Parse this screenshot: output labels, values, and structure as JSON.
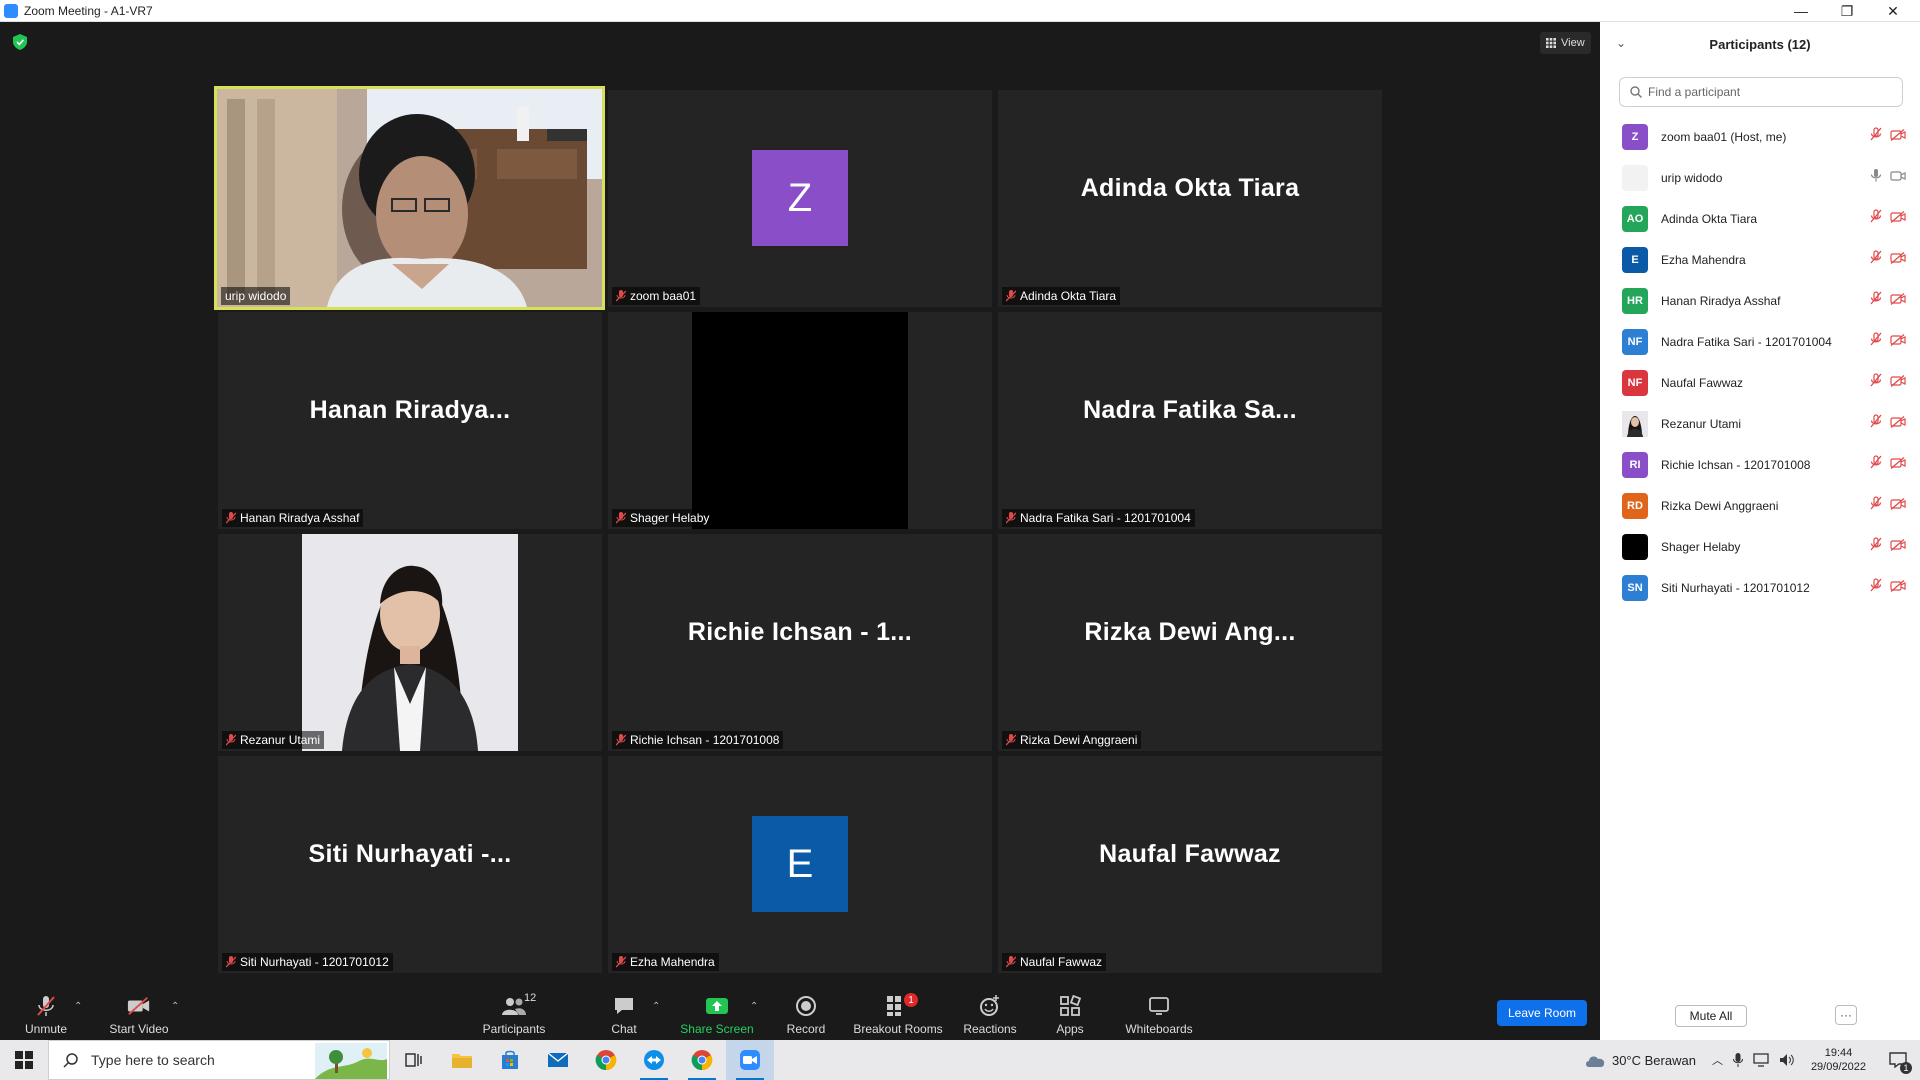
{
  "window": {
    "title": "Zoom Meeting - A1-VR7",
    "minimize": "—",
    "maximize": "❐",
    "close": "✕"
  },
  "view_button": "View",
  "tiles": [
    {
      "label": "urip widodo",
      "type": "video-man",
      "active": true
    },
    {
      "label": "zoom baa01",
      "type": "avatar",
      "letter": "Z",
      "color": "#8a4fc8"
    },
    {
      "label": "Adinda Okta Tiara",
      "type": "name",
      "big": "Adinda Okta Tiara"
    },
    {
      "label": "Hanan Riradya Asshaf",
      "type": "name",
      "big": "Hanan  Riradya..."
    },
    {
      "label": "Shager Helaby",
      "type": "black"
    },
    {
      "label": "Nadra Fatika Sari - 1201701004",
      "type": "name",
      "big": "Nadra Fatika Sa..."
    },
    {
      "label": "Rezanur Utami",
      "type": "photo-woman"
    },
    {
      "label": "Richie Ichsan - 1201701008",
      "type": "name",
      "big": "Richie Ichsan - 1..."
    },
    {
      "label": "Rizka Dewi Anggraeni",
      "type": "name",
      "big": "Rizka Dewi Ang..."
    },
    {
      "label": "Siti Nurhayati - 1201701012",
      "type": "name",
      "big": "Siti Nurhayati -..."
    },
    {
      "label": "Ezha Mahendra",
      "type": "avatar",
      "letter": "E",
      "color": "#0a5aa8"
    },
    {
      "label": "Naufal Fawwaz",
      "type": "name",
      "big": "Naufal Fawwaz"
    }
  ],
  "toolbar": {
    "unmute": "Unmute",
    "start_video": "Start Video",
    "participants": "Participants",
    "participants_count": "12",
    "chat": "Chat",
    "share_screen": "Share Screen",
    "record": "Record",
    "breakout_rooms": "Breakout Rooms",
    "breakout_badge": "1",
    "reactions": "Reactions",
    "apps": "Apps",
    "whiteboards": "Whiteboards",
    "leave_room": "Leave Room"
  },
  "panel": {
    "title": "Participants (12)",
    "search_placeholder": "Find a participant",
    "participants": [
      {
        "initials": "Z",
        "name": "zoom baa01 (Host, me)",
        "color": "#8a4fc8",
        "muted": true
      },
      {
        "initials": "",
        "name": "urip widodo",
        "color": "#f2f2f2",
        "muted": false
      },
      {
        "initials": "AO",
        "name": "Adinda Okta Tiara",
        "color": "#23a55a",
        "muted": true
      },
      {
        "initials": "E",
        "name": "Ezha Mahendra",
        "color": "#0a5aa8",
        "muted": true
      },
      {
        "initials": "HR",
        "name": "Hanan Riradya Asshaf",
        "color": "#23a55a",
        "muted": true
      },
      {
        "initials": "NF",
        "name": "Nadra Fatika Sari - 1201701004",
        "color": "#2d7fd3",
        "muted": true
      },
      {
        "initials": "NF",
        "name": "Naufal Fawwaz",
        "color": "#d9363e",
        "muted": true
      },
      {
        "initials": "",
        "name": "Rezanur Utami",
        "color": "#cfcfcf",
        "muted": true
      },
      {
        "initials": "RI",
        "name": "Richie Ichsan - 1201701008",
        "color": "#8a4fc8",
        "muted": true
      },
      {
        "initials": "RD",
        "name": "Rizka Dewi Anggraeni",
        "color": "#e0651a",
        "muted": true
      },
      {
        "initials": "",
        "name": "Shager Helaby",
        "color": "#000000",
        "muted": true
      },
      {
        "initials": "SN",
        "name": "Siti Nurhayati - 1201701012",
        "color": "#2d7fd3",
        "muted": true
      }
    ],
    "mute_all": "Mute All",
    "more": "···"
  },
  "taskbar": {
    "search_placeholder": "Type here to search",
    "weather": "30°C  Berawan",
    "time": "19:44",
    "date": "29/09/2022",
    "notification_count": "1"
  }
}
